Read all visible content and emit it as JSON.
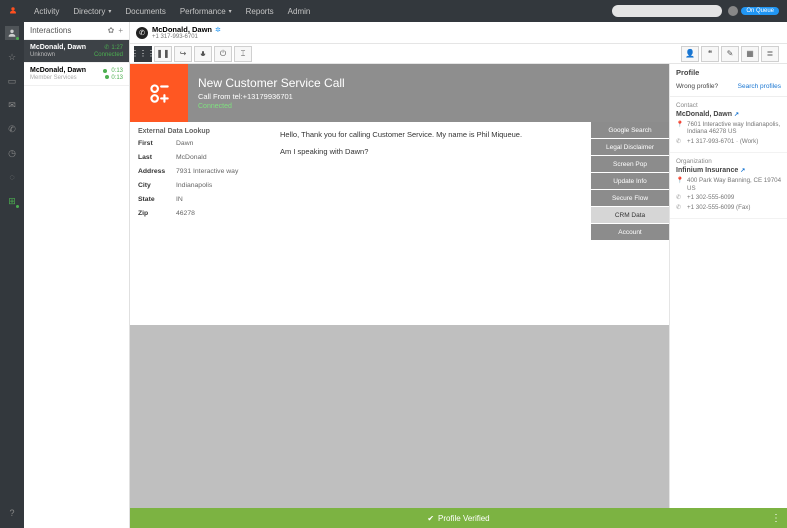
{
  "topnav": {
    "items": [
      "Activity",
      "Directory",
      "Documents",
      "Performance",
      "Reports",
      "Admin"
    ],
    "dropdowns": [
      false,
      true,
      false,
      true,
      false,
      false
    ],
    "queue_badge": "On Queue"
  },
  "interactions": {
    "title": "Interactions",
    "cards": [
      {
        "name": "McDonald, Dawn",
        "time": "1:27",
        "sub": "Unknown",
        "status": "Connected",
        "selected": true
      },
      {
        "name": "McDonald, Dawn",
        "time": "0:13",
        "sub": "Member Services",
        "status": "0:13",
        "selected": false
      }
    ]
  },
  "caller": {
    "name": "McDonald, Dawn",
    "number": "+1 317-993-6701"
  },
  "hero": {
    "title": "New Customer Service Call",
    "sub": "Call From tel:+13179936701",
    "status": "Connected"
  },
  "lookup": {
    "heading": "External Data Lookup",
    "rows": [
      {
        "label": "First",
        "val": "Dawn"
      },
      {
        "label": "Last",
        "val": "McDonald"
      },
      {
        "label": "Address",
        "val": "7931 Interactive way"
      },
      {
        "label": "City",
        "val": "Indianapolis"
      },
      {
        "label": "State",
        "val": "IN"
      },
      {
        "label": "Zip",
        "val": "46278"
      }
    ]
  },
  "script": {
    "line1": "Hello, Thank you for calling Customer Service. My name is Phil Miqueue.",
    "line2": "Am I speaking with Dawn?"
  },
  "actions": [
    "Google Search",
    "Legal Disclaimer",
    "Screen Pop",
    "Update Info",
    "Secure Flow",
    "CRM Data",
    "Account"
  ],
  "actions_selected": 5,
  "profile": {
    "title": "Profile",
    "wrong": "Wrong profile?",
    "search": "Search profiles",
    "contact_label": "Contact",
    "contact_name": "McDonald, Dawn",
    "contact_addr": "7601 Interactive way Indianapolis, Indiana 46278 US",
    "contact_phone": "+1 317-993-6701",
    "contact_phone_type": "(Work)",
    "org_label": "Organization",
    "org_name": "Infinium Insurance",
    "org_addr": "400 Park Way Banning, CE 19704 US",
    "org_phone1": "+1 302-555-6099",
    "org_phone2": "+1 302-555-6099 (Fax)"
  },
  "verify": {
    "text": "Profile Verified"
  }
}
